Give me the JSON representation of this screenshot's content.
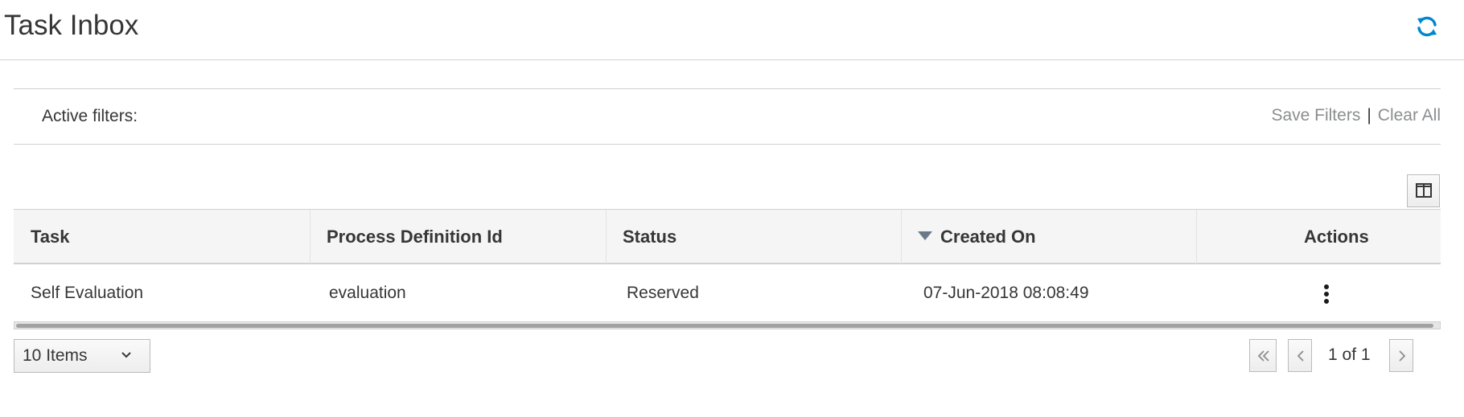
{
  "header": {
    "title": "Task Inbox",
    "refresh_icon": "refresh-icon",
    "accent_color": "#0088ce"
  },
  "filters": {
    "label": "Active filters:",
    "save_label": "Save Filters",
    "separator": "|",
    "clear_label": "Clear All"
  },
  "toolbar": {
    "column_picker_icon": "columns-icon"
  },
  "table": {
    "columns": [
      {
        "label": "Task"
      },
      {
        "label": "Process Definition Id"
      },
      {
        "label": "Status"
      },
      {
        "label": "Created On",
        "sorted": "descending"
      },
      {
        "label": "Actions"
      }
    ],
    "rows": [
      {
        "task": "Self Evaluation",
        "process_definition_id": "evaluation",
        "status": "Reserved",
        "created_on": "07-Jun-2018 08:08:49",
        "actions_icon": "kebab-menu-icon"
      }
    ]
  },
  "pagination": {
    "page_size": "10 Items",
    "page_indicator": "1 of 1",
    "first_icon": "double-chevron-left-icon",
    "prev_icon": "chevron-left-icon",
    "next_icon": "chevron-right-icon"
  }
}
